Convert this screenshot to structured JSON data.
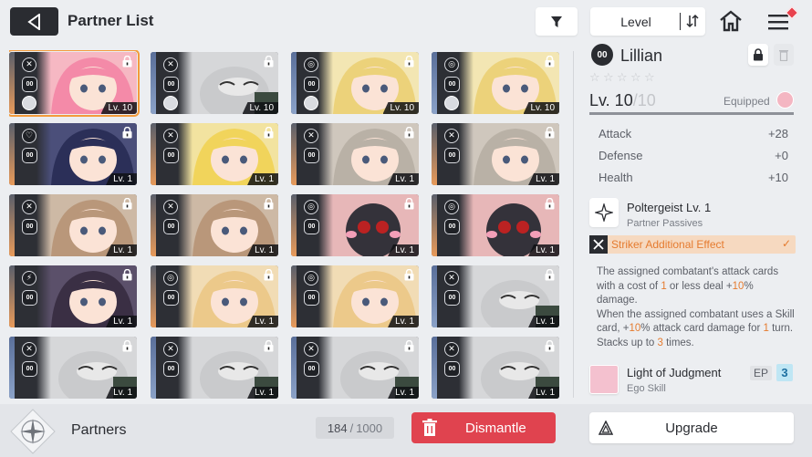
{
  "header": {
    "title": "Partner List",
    "sort_label": "Level"
  },
  "grid": {
    "cards": [
      {
        "level": "Lv. 10",
        "rank": "00",
        "selected": true,
        "tone": "orange",
        "bg": "#f6b8c3",
        "char": "pink"
      },
      {
        "level": "Lv. 10",
        "rank": "00",
        "selected": false,
        "tone": "blue",
        "bg": "#d6d7d9",
        "char": "bird"
      },
      {
        "level": "Lv. 10",
        "rank": "00",
        "selected": false,
        "tone": "blue",
        "bg": "#f3e6b3",
        "char": "blonde"
      },
      {
        "level": "Lv. 10",
        "rank": "00",
        "selected": false,
        "tone": "blue",
        "bg": "#f3e6b3",
        "char": "blonde"
      },
      {
        "level": "Lv. 1",
        "rank": "00",
        "selected": false,
        "tone": "orange",
        "bg": "#4b4f7a",
        "char": "navy"
      },
      {
        "level": "Lv. 1",
        "rank": "00",
        "selected": false,
        "tone": "orange",
        "bg": "#f2e3a0",
        "char": "yellow"
      },
      {
        "level": "Lv. 1",
        "rank": "00",
        "selected": false,
        "tone": "orange",
        "bg": "#cfc7bd",
        "char": "gray"
      },
      {
        "level": "Lv. 1",
        "rank": "00",
        "selected": false,
        "tone": "orange",
        "bg": "#cfc7bd",
        "char": "gray"
      },
      {
        "level": "Lv. 1",
        "rank": "00",
        "selected": false,
        "tone": "orange",
        "bg": "#cdb9a5",
        "char": "brown"
      },
      {
        "level": "Lv. 1",
        "rank": "00",
        "selected": false,
        "tone": "orange",
        "bg": "#cdb9a5",
        "char": "brown"
      },
      {
        "level": "Lv. 1",
        "rank": "00",
        "selected": false,
        "tone": "orange",
        "bg": "#e7b7b8",
        "char": "blob"
      },
      {
        "level": "Lv. 1",
        "rank": "00",
        "selected": false,
        "tone": "orange",
        "bg": "#e7b7b8",
        "char": "blob"
      },
      {
        "level": "Lv. 1",
        "rank": "00",
        "selected": false,
        "tone": "orange",
        "bg": "#5b506a",
        "char": "glasses"
      },
      {
        "level": "Lv. 1",
        "rank": "00",
        "selected": false,
        "tone": "orange",
        "bg": "#f1dcb5",
        "char": "sleepy"
      },
      {
        "level": "Lv. 1",
        "rank": "00",
        "selected": false,
        "tone": "orange",
        "bg": "#f1dcb5",
        "char": "sleepy"
      },
      {
        "level": "Lv. 1",
        "rank": "00",
        "selected": false,
        "tone": "blue",
        "bg": "#d6d7d9",
        "char": "bird"
      },
      {
        "level": "Lv. 1",
        "rank": "00",
        "selected": false,
        "tone": "blue",
        "bg": "#d6d7d9",
        "char": "bird"
      },
      {
        "level": "Lv. 1",
        "rank": "00",
        "selected": false,
        "tone": "blue",
        "bg": "#d6d7d9",
        "char": "bird"
      },
      {
        "level": "Lv. 1",
        "rank": "00",
        "selected": false,
        "tone": "blue",
        "bg": "#d6d7d9",
        "char": "bird"
      },
      {
        "level": "Lv. 1",
        "rank": "00",
        "selected": false,
        "tone": "blue",
        "bg": "#d6d7d9",
        "char": "bird"
      }
    ]
  },
  "footer": {
    "section_label": "Partners",
    "count_current": "184",
    "count_sep": "/",
    "count_max": "1000",
    "dismantle_label": "Dismantle",
    "upgrade_label": "Upgrade"
  },
  "detail": {
    "rank": "00",
    "name": "Lillian",
    "stars": [
      "☆",
      "☆",
      "☆",
      "☆",
      "☆"
    ],
    "level_prefix": "Lv. 10",
    "level_max": "/10",
    "level_progress": 1.0,
    "equipped_label": "Equipped",
    "stats": [
      {
        "k": "Attack",
        "v": "+28"
      },
      {
        "k": "Defense",
        "v": "+0"
      },
      {
        "k": "Health",
        "v": "+10"
      }
    ],
    "passive_title": "Poltergeist Lv. 1",
    "passive_sub": "Partner Passives",
    "effect_label": "Striker Additional Effect",
    "desc": {
      "p1": "The assigned combatant's attack cards with a cost of ",
      "n1": "1",
      "p2": " or less deal +",
      "n2": "10",
      "p3": "% damage.",
      "p4": "When the assigned combatant uses a Skill card, +",
      "n3": "10",
      "p5": "% attack card damage for ",
      "n4": "1",
      "p6": " turn. Stacks up to ",
      "n5": "3",
      "p7": " times."
    },
    "ego_title": "Light of Judgment",
    "ego_sub": "Ego Skill",
    "ep_label": "EP",
    "ep_value": "3"
  },
  "colors": {
    "accent_orange": "#e57b2f",
    "dismantle_red": "#e0434f",
    "selected_outline": "#f39b3b"
  }
}
